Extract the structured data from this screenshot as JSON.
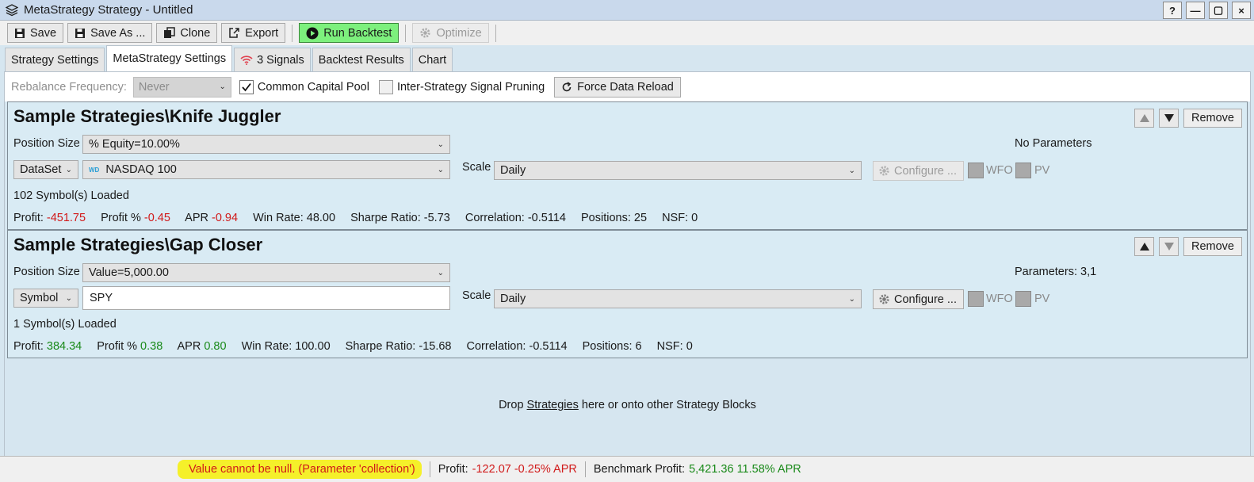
{
  "window": {
    "title": "MetaStrategy Strategy - Untitled",
    "buttons": {
      "help": "?",
      "minimize": "—",
      "maximize": "▢",
      "close": "×"
    }
  },
  "toolbar": {
    "save": "Save",
    "save_as": "Save As ...",
    "clone": "Clone",
    "export": "Export",
    "run_backtest": "Run Backtest",
    "optimize": "Optimize"
  },
  "tabs": [
    {
      "label": "Strategy Settings"
    },
    {
      "label": "MetaStrategy Settings",
      "active": true
    },
    {
      "label": "3 Signals"
    },
    {
      "label": "Backtest Results"
    },
    {
      "label": "Chart"
    }
  ],
  "options": {
    "rebalance_label": "Rebalance Frequency:",
    "rebalance_value": "Never",
    "common_capital_pool": {
      "label": "Common Capital Pool",
      "checked": true
    },
    "signal_pruning": {
      "label": "Inter-Strategy Signal Pruning",
      "checked": false
    },
    "force_reload": "Force Data Reload"
  },
  "strategies": [
    {
      "name": "Sample Strategies\\Knife Juggler",
      "remove": "Remove",
      "position_size_label": "Position Size",
      "position_size": "% Equity=10.00%",
      "source_type": "DataSet",
      "source_value": "NASDAQ 100",
      "source_badge": "WD",
      "scale_label": "Scale",
      "scale": "Daily",
      "configure": "Configure ...",
      "configure_enabled": false,
      "wfo": "WFO",
      "pv": "PV",
      "params": "No Parameters",
      "loaded": "102 Symbol(s) Loaded",
      "stats": {
        "profit_label": "Profit:",
        "profit": "-451.75",
        "profit_pct_label": "Profit %",
        "profit_pct": "-0.45",
        "apr_label": "APR",
        "apr": "-0.94",
        "win_rate": "Win Rate: 48.00",
        "sharpe": "Sharpe Ratio: -5.73",
        "correlation": "Correlation: -0.5114",
        "positions": "Positions: 25",
        "nsf": "NSF: 0"
      }
    },
    {
      "name": "Sample Strategies\\Gap Closer",
      "remove": "Remove",
      "position_size_label": "Position Size",
      "position_size": "Value=5,000.00",
      "source_type": "Symbol",
      "source_value": "SPY",
      "scale_label": "Scale",
      "scale": "Daily",
      "configure": "Configure ...",
      "configure_enabled": true,
      "wfo": "WFO",
      "pv": "PV",
      "params": "Parameters: 3,1",
      "loaded": "1 Symbol(s) Loaded",
      "stats": {
        "profit_label": "Profit:",
        "profit": "384.34",
        "profit_pct_label": "Profit %",
        "profit_pct": "0.38",
        "apr_label": "APR",
        "apr": "0.80",
        "win_rate": "Win Rate: 100.00",
        "sharpe": "Sharpe Ratio: -15.68",
        "correlation": "Correlation: -0.5114",
        "positions": "Positions: 6",
        "nsf": "NSF: 0"
      }
    }
  ],
  "dropzone": {
    "prefix": "Drop",
    "link": "Strategies",
    "suffix": "here or onto other Strategy Blocks"
  },
  "status": {
    "error": "Value cannot be null. (Parameter 'collection')",
    "profit_label": "Profit:",
    "profit_value": "-122.07 -0.25% APR",
    "benchmark_label": "Benchmark Profit:",
    "benchmark_value": "5,421.36 11.58% APR"
  },
  "colors": {
    "negative": "#d11a1a",
    "positive": "#1a8a1a",
    "run": "#7df07d",
    "highlight": "#f5f02a"
  }
}
